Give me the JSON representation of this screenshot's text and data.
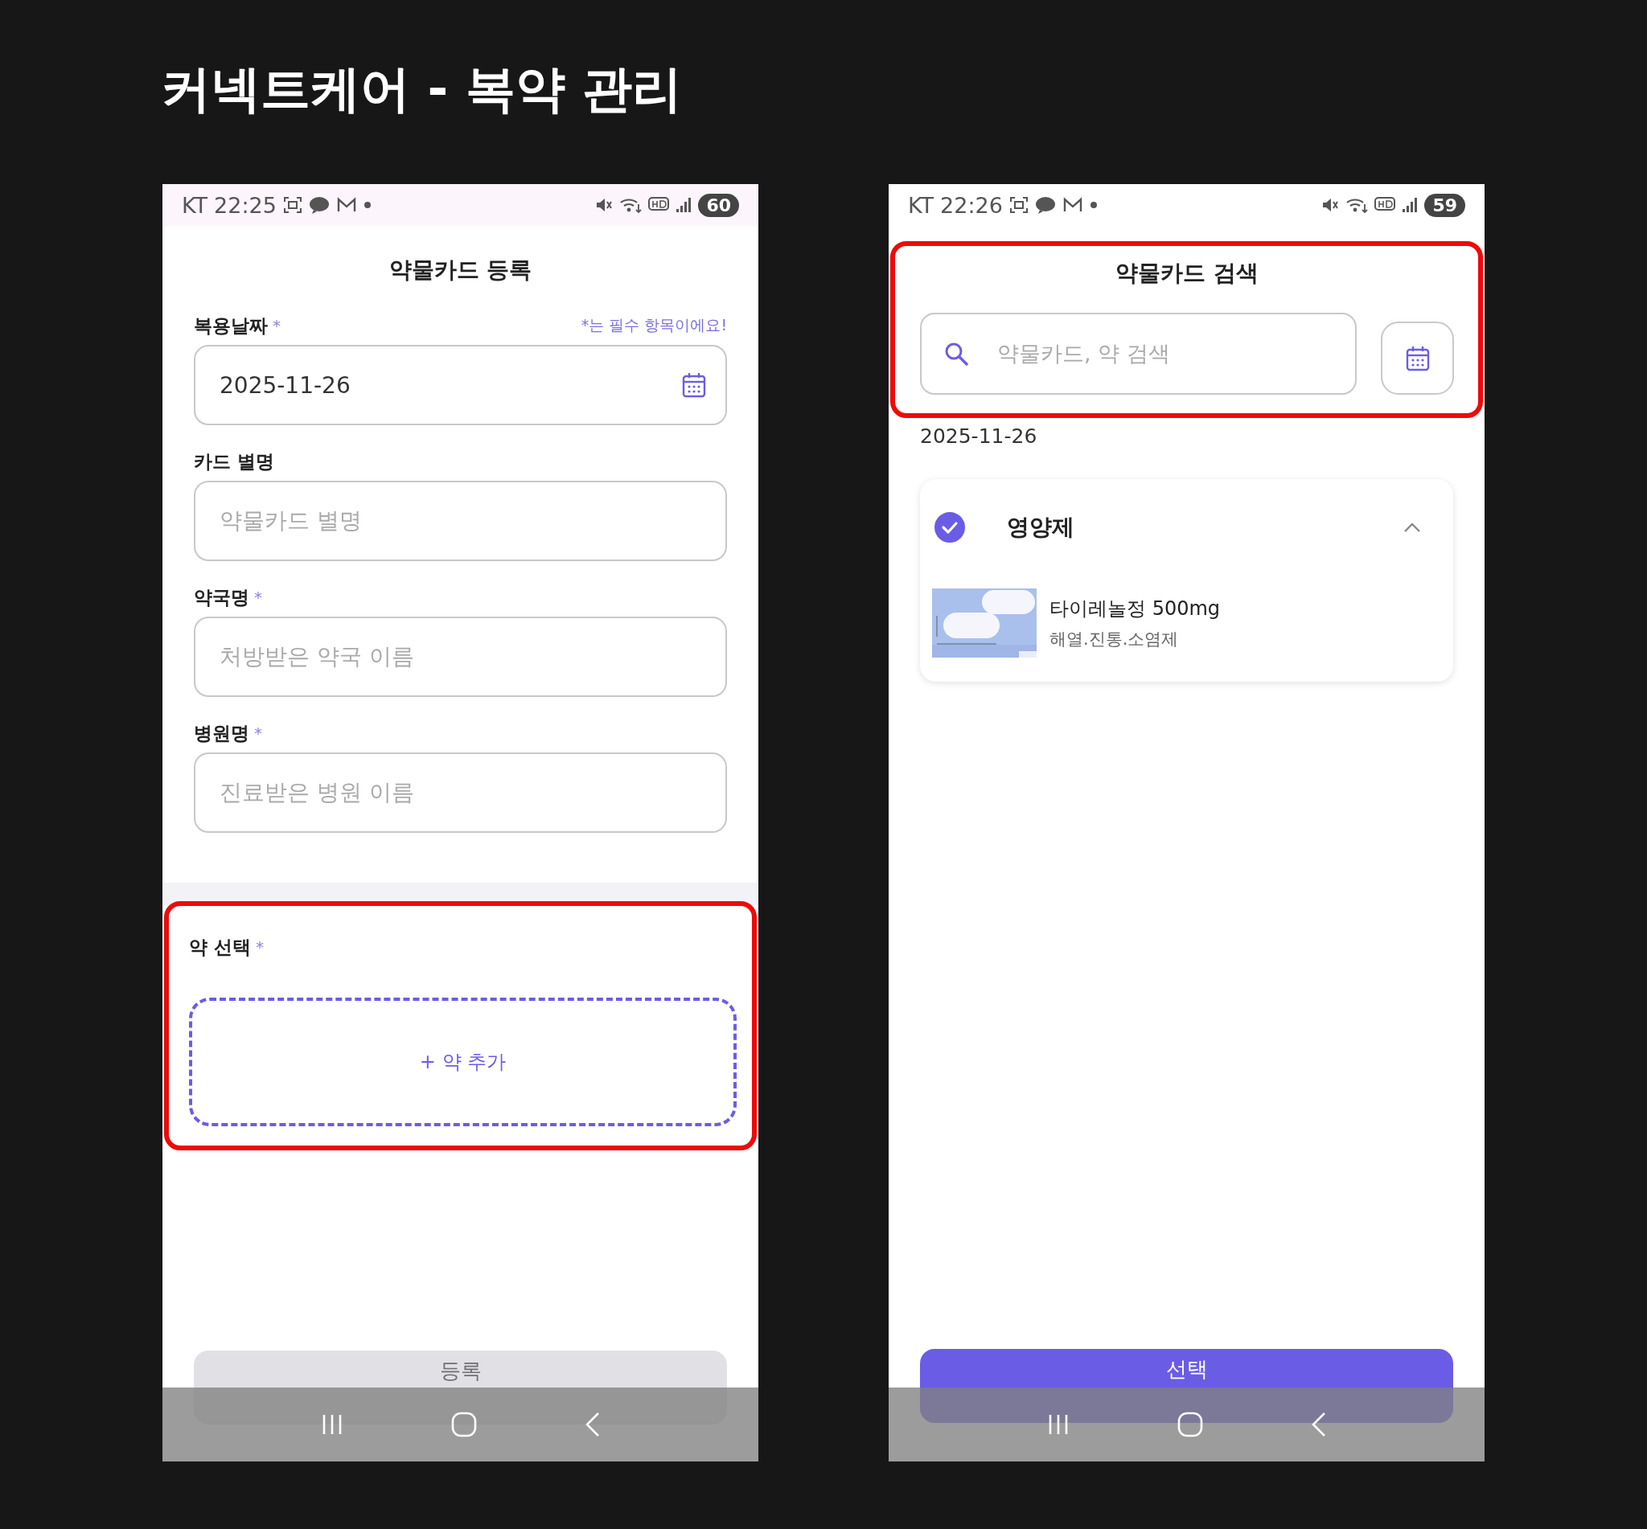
{
  "title": "커넥트케어 - 복약 관리",
  "screens": [
    {
      "kind": "register",
      "status_bar": {
        "carrier": "KT",
        "time": "22:25",
        "battery": "60"
      },
      "header": "약물카드 등록",
      "required_note": "*는 필수 항목이에요!",
      "fields": [
        {
          "label": "복용날짜",
          "required_mark": "*",
          "kind": "date",
          "value": "2025-11-26"
        },
        {
          "label": "카드 별명",
          "kind": "text",
          "placeholder": "약물카드 별명"
        },
        {
          "label": "약국명",
          "required_mark": "*",
          "kind": "text",
          "placeholder": "처방받은 약국 이름"
        },
        {
          "label": "병원명",
          "required_mark": "*",
          "kind": "text",
          "placeholder": "진료받은 병원 이름"
        }
      ],
      "medicine_section": {
        "label": "약 선택",
        "required_mark": "*",
        "highlighted": true,
        "add_button": "+ 약 추가"
      },
      "submit_button": {
        "label": "등록",
        "disabled": true
      }
    },
    {
      "kind": "search",
      "status_bar": {
        "carrier": "KT",
        "time": "22:26",
        "battery": "59"
      },
      "header": "약물카드 검색",
      "highlighted": true,
      "search": {
        "placeholder": "약물카드, 약 검색"
      },
      "date": "2025-11-26",
      "groups": [
        {
          "name": "영양제",
          "checked": true,
          "expanded": true,
          "items": [
            {
              "name": "타이레놀정 500mg",
              "category": "해열.진통.소염제"
            }
          ]
        }
      ],
      "select_button": {
        "label": "선택",
        "disabled": false
      }
    }
  ]
}
